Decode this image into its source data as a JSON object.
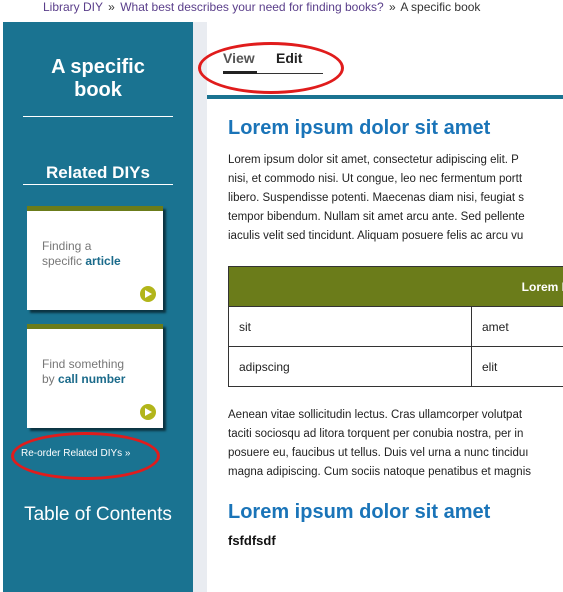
{
  "breadcrumb": {
    "items": [
      "Library DIY",
      "What best describes your need for finding books?"
    ],
    "separator": "»",
    "current": "A specific book"
  },
  "sidebar": {
    "title_line1": "A specific",
    "title_line2": "book",
    "related_heading": "Related DIYs",
    "cards": [
      {
        "line1": "Finding a",
        "line2_prefix": "specific ",
        "line2_bold": "article",
        "arrow_icon": "arrow-right-icon"
      },
      {
        "line1": "Find something",
        "line2_prefix": "by ",
        "line2_bold": "call number",
        "arrow_icon": "arrow-right-icon"
      }
    ],
    "reorder_link": "Re-order Related DIYs »",
    "table_of_contents": "Table of Contents"
  },
  "tabs": {
    "view": "View",
    "edit": "Edit",
    "active": "View"
  },
  "content": {
    "heading1": "Lorem ipsum dolor sit amet",
    "paragraph1": [
      "Lorem ipsum dolor sit amet, consectetur adipiscing elit. P",
      "nisi, et commodo nisi. Ut congue, leo nec fermentum portt",
      "libero. Suspendisse potenti. Maecenas diam nisi, feugiat s",
      "tempor bibendum. Nullam sit amet arcu ante. Sed pellente",
      "iaculis velit sed tincidunt. Aliquam posuere felis ac arcu vu"
    ],
    "table": {
      "header": "Lorem I",
      "rows": [
        [
          "sit",
          "amet"
        ],
        [
          "adipscing",
          "elit"
        ]
      ]
    },
    "paragraph2": [
      "Aenean vitae sollicitudin lectus. Cras ullamcorper volutpat",
      "taciti sociosqu ad litora torquent per conubia nostra, per in",
      "posuere eu, faucibus ut tellus. Duis vel urna a nunc tinciduı",
      "magna adipiscing. Cum sociis natoque penatibus et magnis"
    ],
    "heading2": "Lorem ipsum dolor sit amet",
    "small_text": "fsfdfsdf"
  },
  "colors": {
    "sidebar": "#1a7391",
    "card_accent": "#6b7c1a",
    "heading": "#1a74b8",
    "annotation": "#e01c1c"
  }
}
